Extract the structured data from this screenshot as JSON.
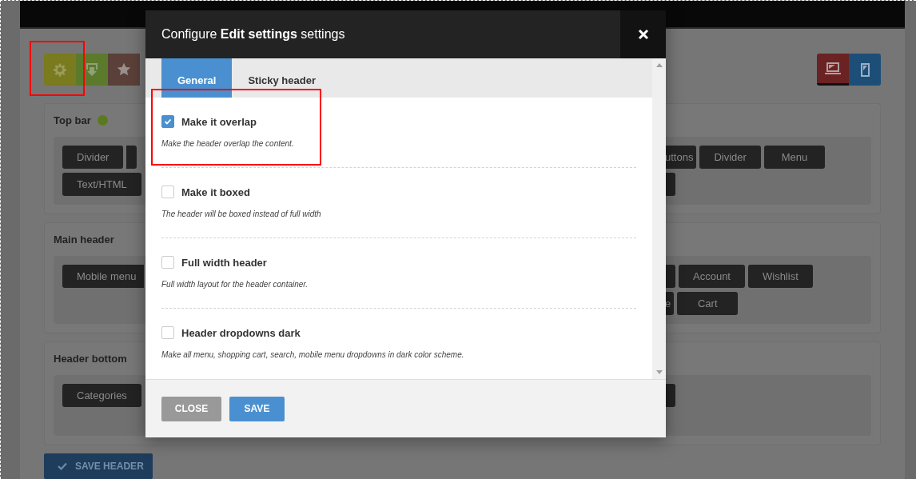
{
  "devices": [
    {
      "kind": "desktop",
      "selected": true
    },
    {
      "kind": "mobile",
      "selected": false
    }
  ],
  "panels": [
    {
      "title": "Top bar",
      "color": "#5b7a1f",
      "left_rows": [
        [
          {
            "label": "Divider"
          },
          {
            "kind": "partial"
          }
        ],
        [
          {
            "label": "Text/HTML"
          }
        ]
      ],
      "right_rows": [
        [
          {
            "label": "uttons",
            "kind": "cut"
          },
          {
            "label": "Divider"
          },
          {
            "label": "Menu"
          }
        ],
        [
          {
            "kind": "partial"
          }
        ]
      ]
    },
    {
      "title": "Main header",
      "left_rows": [
        [
          {
            "label": "Mobile menu"
          }
        ]
      ],
      "right_rows": [
        [
          {
            "kind": "partial"
          },
          {
            "label": "Account"
          },
          {
            "label": "Wishlist"
          }
        ],
        [
          {
            "label": "e",
            "kind": "cut"
          },
          {
            "label": "Cart"
          }
        ]
      ]
    },
    {
      "title": "Header bottom",
      "left_rows": [
        [
          {
            "label": "Categories"
          }
        ]
      ],
      "right_rows": [
        [
          {
            "kind": "partial"
          }
        ]
      ]
    }
  ],
  "save_header": "SAVE HEADER",
  "modal": {
    "title": "Configure **Edit settings** settings",
    "tabs": [
      {
        "label": "General",
        "selected": true
      },
      {
        "label": "Sticky header",
        "selected": false
      }
    ],
    "options": [
      {
        "label": "Make it overlap",
        "description": "Make the header overlap the content.",
        "checked": true
      },
      {
        "label": "Make it boxed",
        "description": "The header will be boxed instead of full width",
        "checked": false
      },
      {
        "label": "Full width header",
        "description": "Full width layout for the header container.",
        "checked": false
      },
      {
        "label": "Header dropdowns dark",
        "description": "Make all menu, shopping cart, search, mobile menu dropdowns in dark color scheme.",
        "checked": false
      }
    ],
    "buttons": [
      {
        "label": "CLOSE",
        "kind": "secondary"
      },
      {
        "label": "SAVE",
        "kind": "primary"
      }
    ]
  }
}
